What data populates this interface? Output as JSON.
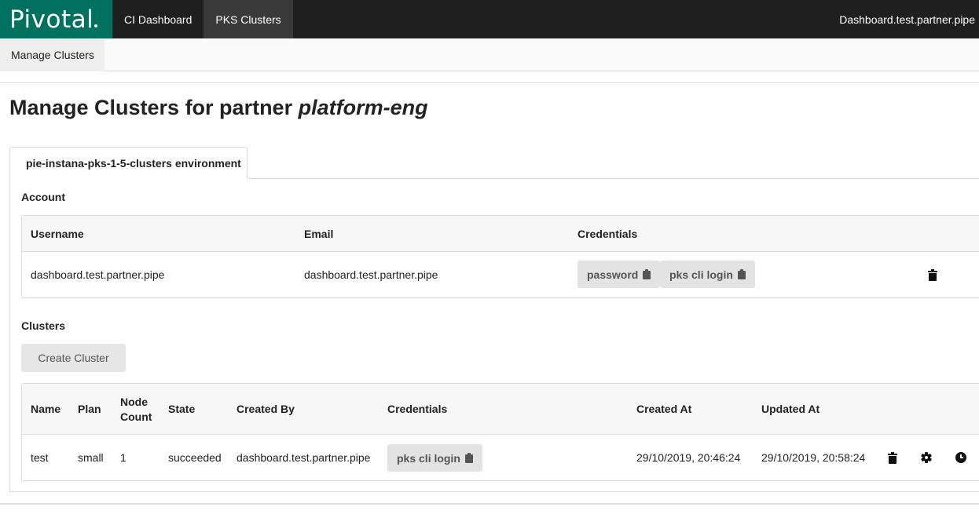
{
  "topbar": {
    "brand": "Pivotal",
    "nav": [
      {
        "label": "CI Dashboard",
        "active": false
      },
      {
        "label": "PKS Clusters",
        "active": true
      }
    ],
    "user": "Dashboard.test.partner.pipe"
  },
  "subnav": {
    "tab": "Manage Clusters"
  },
  "page": {
    "title_prefix": "Manage Clusters for partner",
    "partner": "platform-eng"
  },
  "environment_tab": "pie-instana-pks-1-5-clusters environment",
  "account": {
    "section_label": "Account",
    "headers": {
      "username": "Username",
      "email": "Email",
      "credentials": "Credentials"
    },
    "row": {
      "username": "dashboard.test.partner.pipe",
      "email": "dashboard.test.partner.pipe",
      "password_button": "password",
      "pks_login_button": "pks cli login"
    }
  },
  "clusters": {
    "section_label": "Clusters",
    "create_button": "Create Cluster",
    "headers": {
      "name": "Name",
      "plan": "Plan",
      "node_count_1": "Node",
      "node_count_2": "Count",
      "state": "State",
      "created_by": "Created By",
      "credentials": "Credentials",
      "created_at": "Created At",
      "updated_at": "Updated At"
    },
    "rows": [
      {
        "name": "test",
        "plan": "small",
        "node_count": "1",
        "state": "succeeded",
        "created_by": "dashboard.test.partner.pipe",
        "pks_login_button": "pks cli login",
        "created_at": "29/10/2019, 20:46:24",
        "updated_at": "29/10/2019, 20:58:24"
      }
    ]
  },
  "colors": {
    "brand_green": "#00705f",
    "topbar": "#1f1f1f",
    "chip_bg": "#e3e3e3"
  },
  "icons": [
    "clipboard-icon",
    "trash-icon",
    "gear-icon",
    "clock-icon"
  ]
}
